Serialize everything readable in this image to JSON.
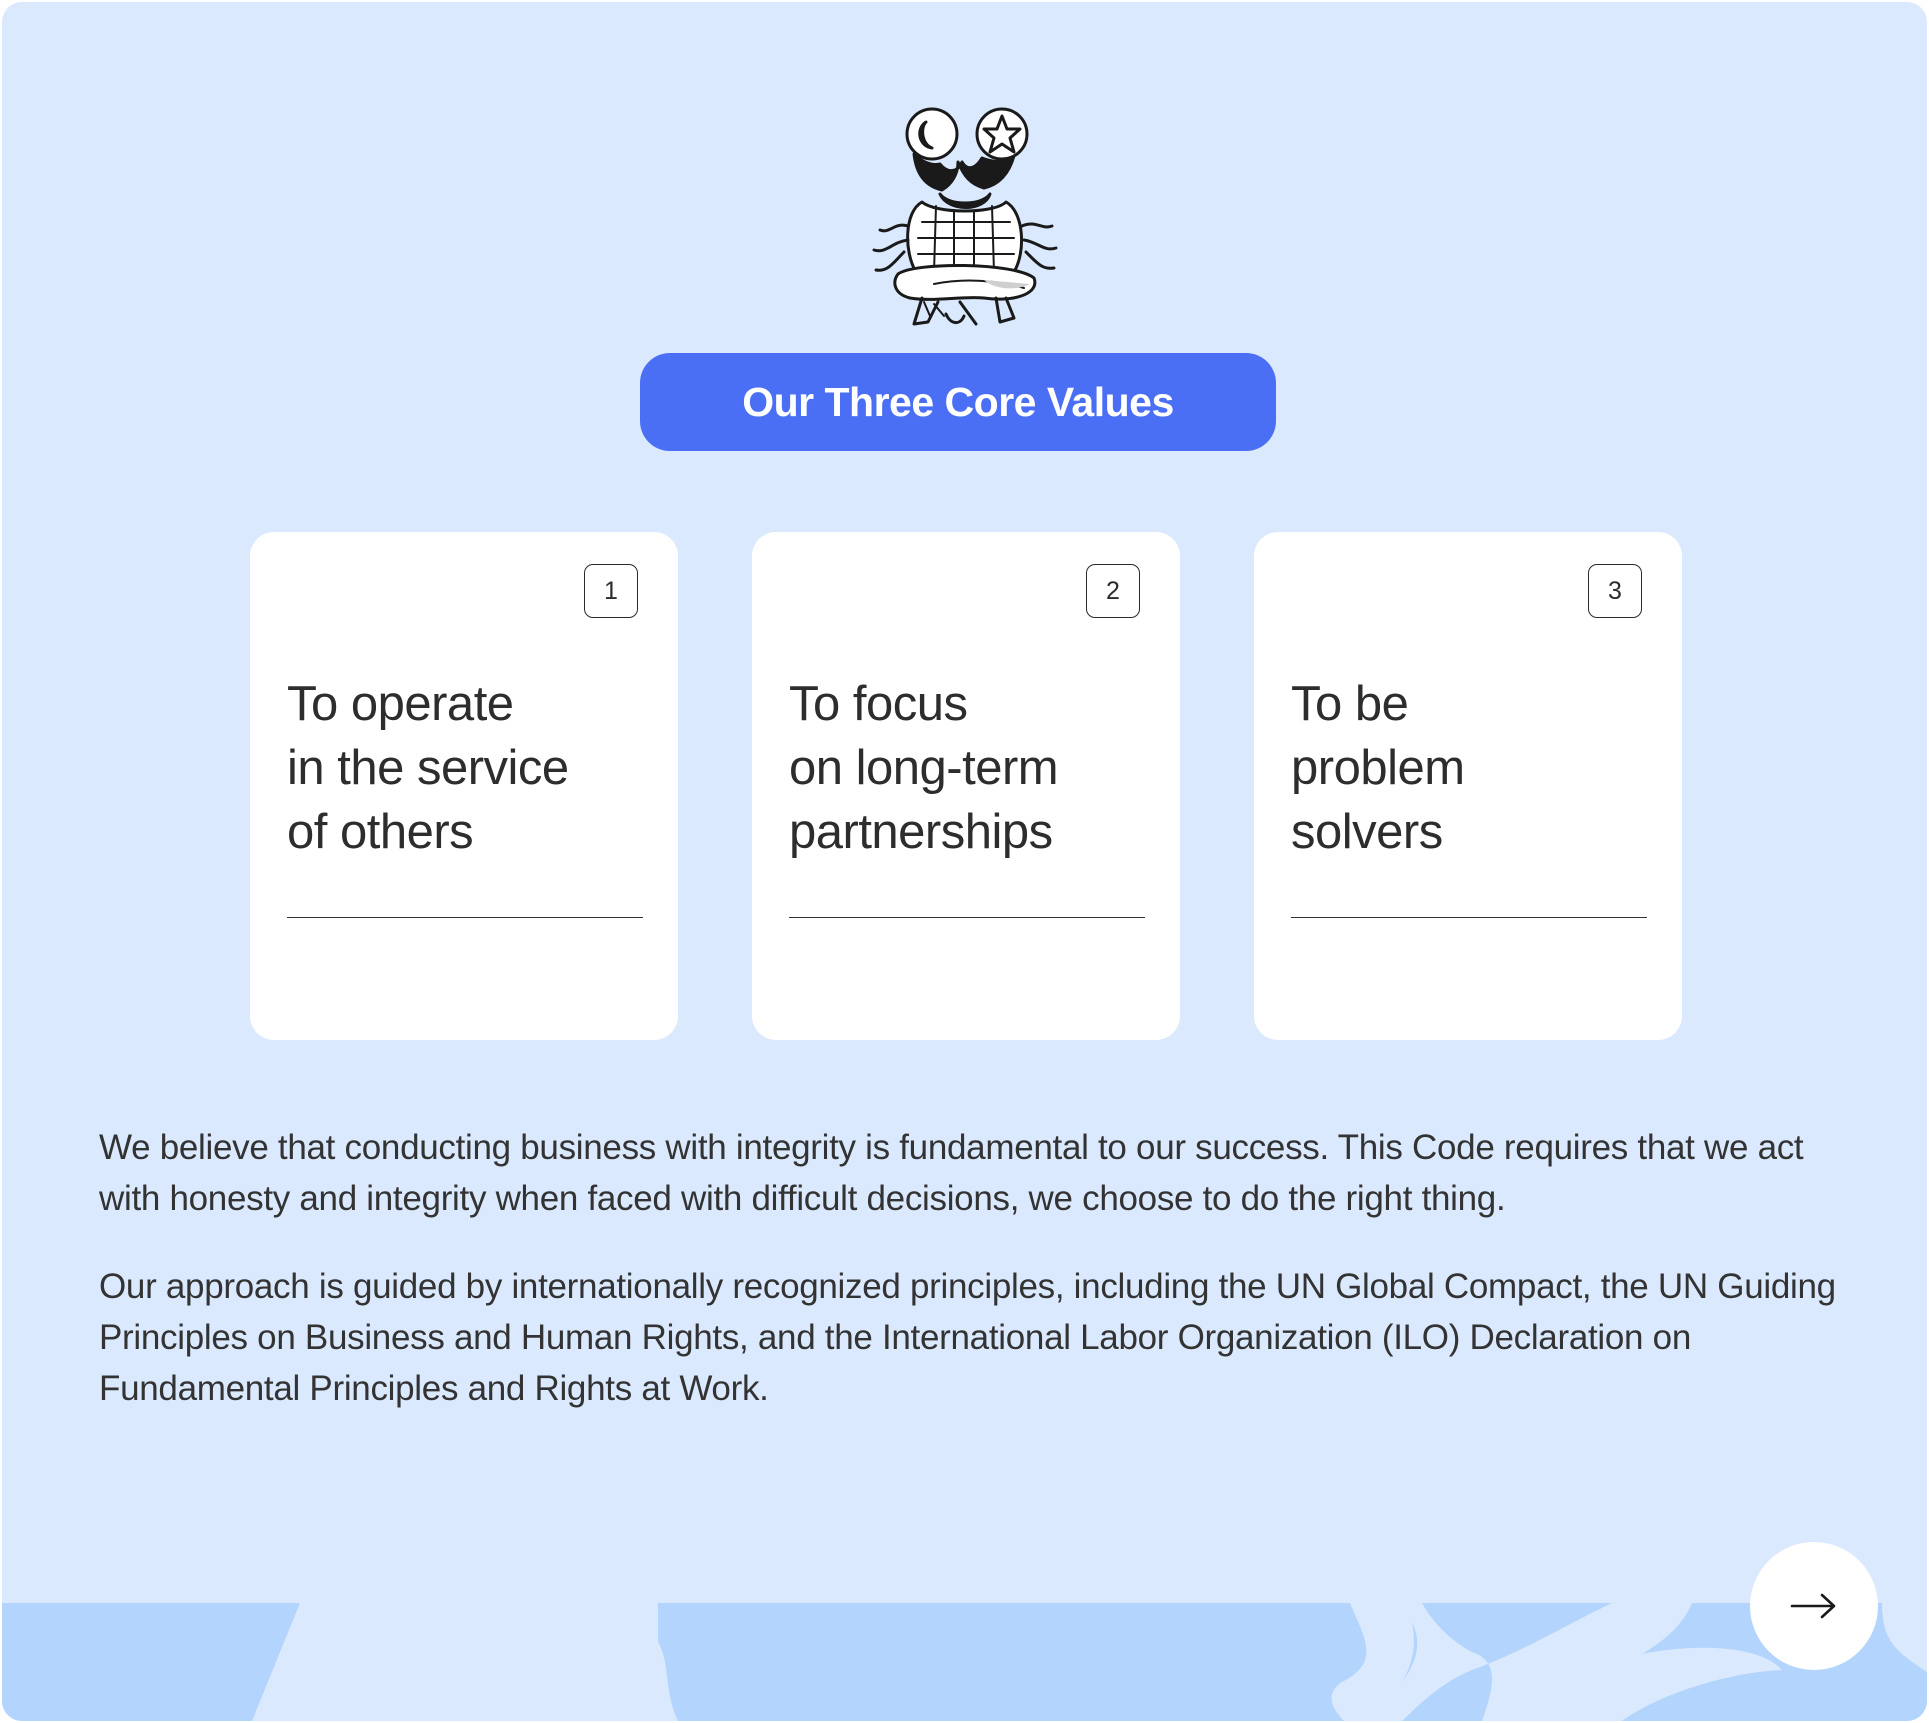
{
  "header": {
    "mascot_icon": "meditating-character-illustration",
    "title": "Our Three Core Values"
  },
  "values": [
    {
      "number": "1",
      "text": "To operate\n in the service\nof others"
    },
    {
      "number": "2",
      "text": "To focus\non long-term\npartnerships"
    },
    {
      "number": "3",
      "text": "To be\nproblem\nsolvers"
    }
  ],
  "body": {
    "paragraph_1": "We believe that conducting business with integrity is fundamental to our success. This Code requires that we act with honesty and integrity when faced with difficult decisions, we choose to do the right thing.",
    "paragraph_2": "Our approach is guided by internationally recognized principles, including the UN Global Compact, the UN Guiding Principles on Business and Human Rights, and the International Labor Organization (ILO) Declaration on Fundamental Principles and Rights at Work."
  },
  "navigation": {
    "next_icon": "arrow-right-icon"
  },
  "colors": {
    "background": "#dbe9fe",
    "accent": "#4a6ff5",
    "decoration": "#b3d5fd",
    "card": "#ffffff",
    "text": "#2d2d2d"
  }
}
